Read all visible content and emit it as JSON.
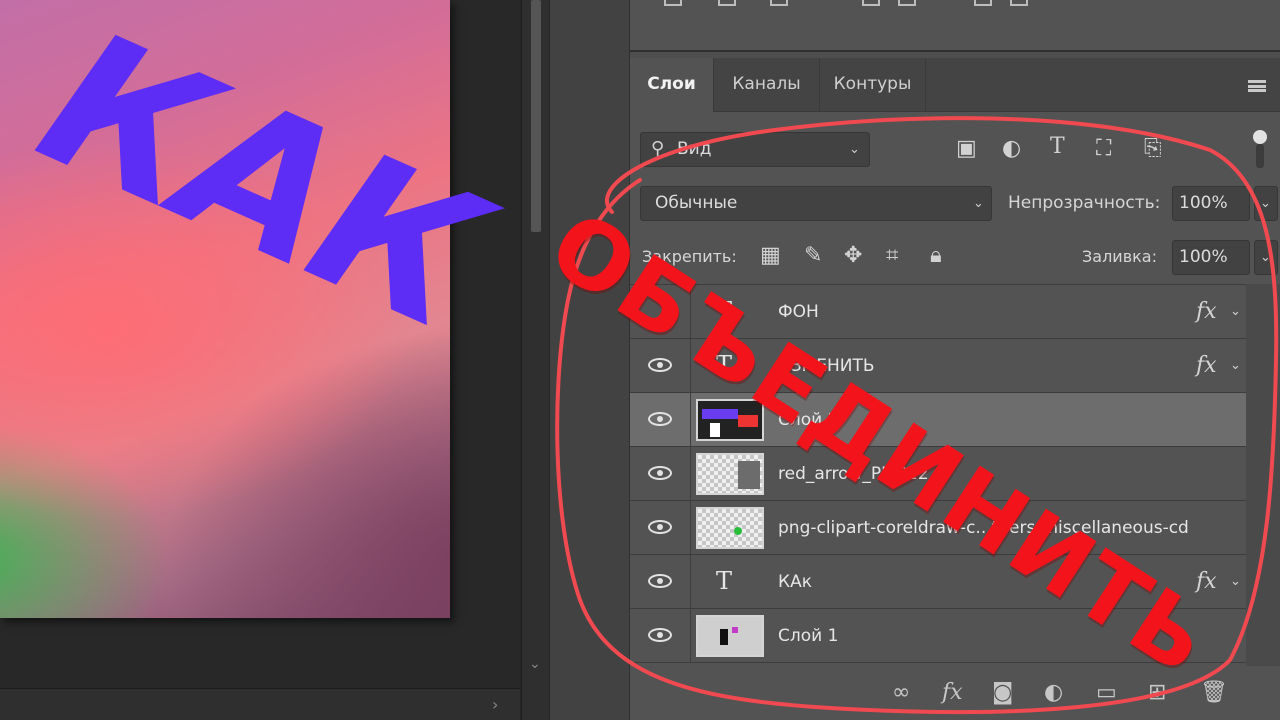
{
  "canvas": {
    "document_text": "КАК",
    "document_text_color": "#5d2cf5"
  },
  "overlay": {
    "text": "ОБЪЕДИНИТЬ",
    "color": "#f2131b"
  },
  "layers_panel": {
    "tabs": [
      {
        "label": "Слои",
        "active": true
      },
      {
        "label": "Каналы",
        "active": false
      },
      {
        "label": "Контуры",
        "active": false
      }
    ],
    "filter": {
      "value": "Вид",
      "icons": [
        "image-filter-icon",
        "adjustment-filter-icon",
        "type-filter-icon",
        "shape-filter-icon",
        "smart-object-filter-icon"
      ]
    },
    "blend_mode": "Обычные",
    "opacity_label": "Непрозрачность:",
    "opacity_value": "100%",
    "lock_label": "Закрепить:",
    "lock_icons": [
      "lock-transparent-pixels-icon",
      "lock-image-pixels-icon",
      "lock-position-icon",
      "lock-artboard-icon",
      "lock-all-icon"
    ],
    "fill_label": "Заливка:",
    "fill_value": "100%",
    "layers": [
      {
        "name": "ФОН",
        "kind": "text",
        "visible": false,
        "fx": true,
        "selected": false
      },
      {
        "name": "ИЗМЕНИТЬ",
        "kind": "text",
        "visible": true,
        "fx": true,
        "selected": false
      },
      {
        "name": "Слой 2",
        "kind": "raster",
        "visible": true,
        "fx": false,
        "selected": true
      },
      {
        "name": "red_arrow_PNG12",
        "kind": "raster",
        "visible": true,
        "fx": false,
        "selected": false
      },
      {
        "name": "png-clipart-coreldraw-c...thers-miscellaneous-cd",
        "kind": "raster",
        "visible": true,
        "fx": false,
        "selected": false
      },
      {
        "name": "КАк",
        "kind": "text",
        "visible": true,
        "fx": true,
        "selected": false
      },
      {
        "name": "Слой 1",
        "kind": "raster",
        "visible": true,
        "fx": false,
        "selected": false
      }
    ],
    "fx_label": "fx",
    "bottom_icons": [
      "link-layers-icon",
      "add-style-icon",
      "add-mask-icon",
      "new-adjustment-layer-icon",
      "new-group-icon",
      "new-layer-icon",
      "delete-layer-icon"
    ]
  }
}
